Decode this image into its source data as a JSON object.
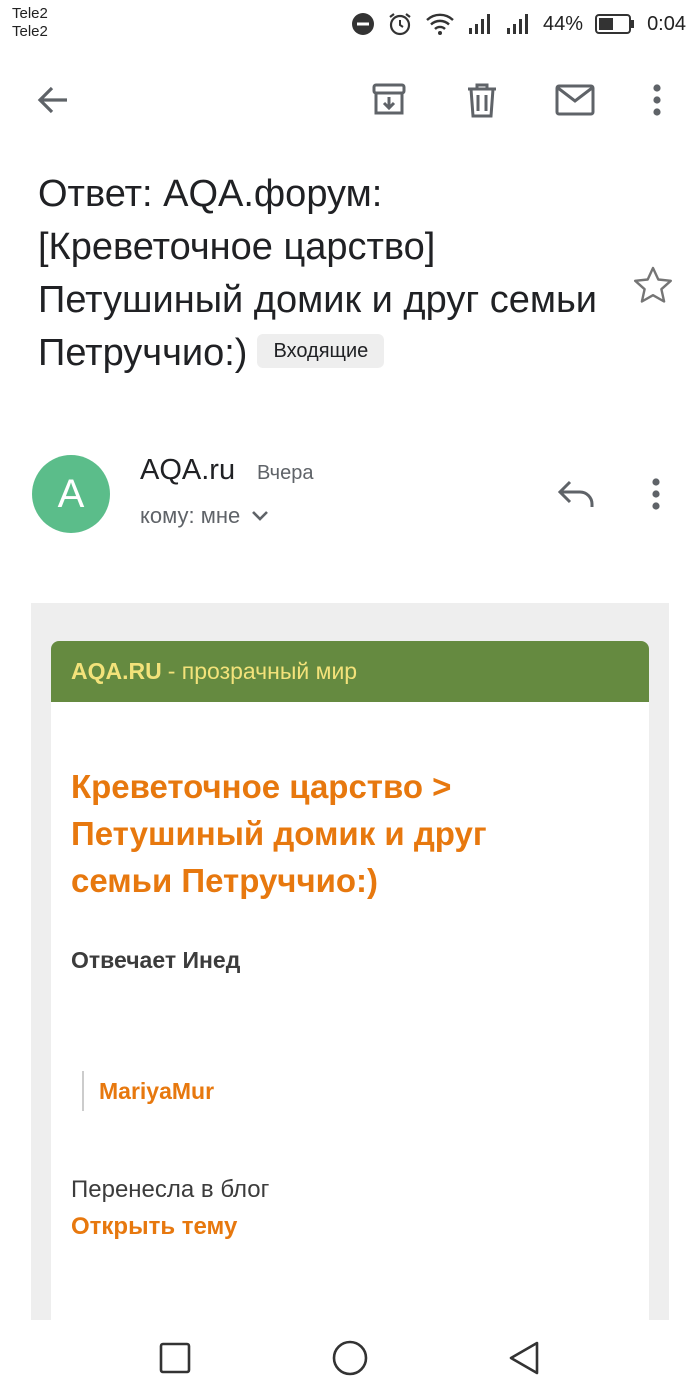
{
  "status_bar": {
    "carrier_1": "Tele2",
    "carrier_2": "Tele2",
    "battery_percent": "44%",
    "time": "0:04",
    "icons": [
      "do-not-disturb-icon",
      "alarm-icon",
      "wifi-icon",
      "signal-icon",
      "signal-icon",
      "battery-icon"
    ]
  },
  "toolbar": {
    "icons": [
      "back-arrow-icon",
      "archive-icon",
      "trash-icon",
      "mail-icon",
      "more-vert-icon"
    ]
  },
  "subject": {
    "text": "Ответ: AQA.форум: [Креветочное царство] Петушиный домик и друг семьи Петруччио:)",
    "label": "Входящие",
    "star_icon": "star-outline-icon"
  },
  "sender": {
    "avatar_letter": "A",
    "avatar_color": "#5bbd8a",
    "name": "AQA.ru",
    "date": "Вчера",
    "recipient": "кому: мне",
    "icons": [
      "chevron-down-icon",
      "reply-icon",
      "more-vert-icon"
    ]
  },
  "email": {
    "brand": "AQA.RU",
    "tagline": "- прозрачный мир",
    "title": "Креветочное царство > Петушиный домик и друг семьи Петруччио:)",
    "author_line": "Отвечает Инед",
    "quote_author": "MariyaMur",
    "message": "Перенесла в блог",
    "open_link": "Открыть тему",
    "colors": {
      "header": "#658a40",
      "accent": "#e7780e",
      "brand_text": "#f3e27a"
    }
  },
  "navbar": {
    "icons": [
      "recents-square-icon",
      "home-circle-icon",
      "back-triangle-icon"
    ]
  }
}
